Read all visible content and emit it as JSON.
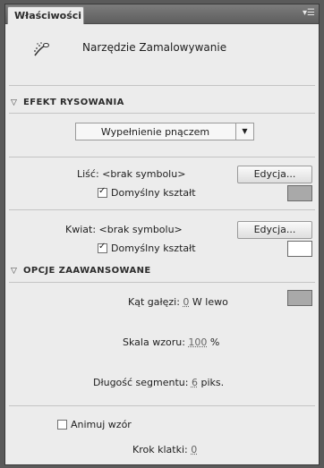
{
  "panel": {
    "tab_title": "Właściwości",
    "menu_icon": "panel-menu-icon"
  },
  "tool": {
    "name": "Narzędzie Zamalowywanie",
    "icon": "spray-brush-icon"
  },
  "effect_section": {
    "header": "EFEKT RYSOWANIA",
    "dropdown_value": "Wypełnienie pnączem"
  },
  "leaf": {
    "label": "Liść:",
    "symbol": "<brak symbolu>",
    "edit_button": "Edycja...",
    "default_shape_label": "Domyślny kształt",
    "default_shape_checked": true,
    "swatch_color": "#a9a9a9"
  },
  "flower": {
    "label": "Kwiat:",
    "symbol": "<brak symbolu>",
    "edit_button": "Edycja...",
    "default_shape_label": "Domyślny kształt",
    "default_shape_checked": true,
    "swatch_color": "#ffffff"
  },
  "advanced_section": {
    "header": "OPCJE ZAAWANSOWANE",
    "branch_angle_label": "Kąt gałęzi:",
    "branch_angle_value": "0",
    "branch_angle_suffix": "W lewo",
    "branch_swatch_color": "#a9a9a9",
    "pattern_scale_label": "Skala wzoru:",
    "pattern_scale_value": "100",
    "pattern_scale_unit": "%",
    "segment_length_label": "Długość segmentu:",
    "segment_length_value": "6",
    "segment_length_unit": "piks.",
    "animate_label": "Animuj wzór",
    "animate_checked": false,
    "frame_step_label": "Krok klatki:",
    "frame_step_value": "0"
  }
}
